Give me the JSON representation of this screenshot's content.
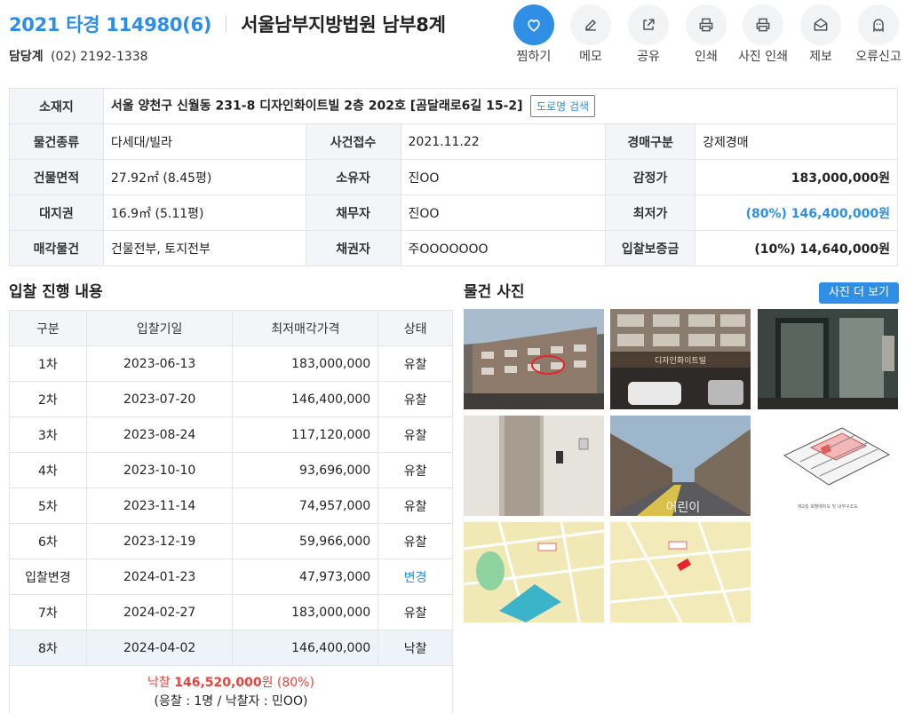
{
  "header": {
    "case_number": "2021 타경 114980(6)",
    "court": "서울남부지방법원 남부8계",
    "contact_label": "담당계",
    "contact_phone": "(02) 2192-1338"
  },
  "actions": [
    {
      "label": "찜하기",
      "icon": "heart-icon"
    },
    {
      "label": "메모",
      "icon": "edit-icon"
    },
    {
      "label": "공유",
      "icon": "share-icon"
    },
    {
      "label": "인쇄",
      "icon": "print-icon"
    },
    {
      "label": "사진 인쇄",
      "icon": "print-icon"
    },
    {
      "label": "제보",
      "icon": "mail-icon"
    },
    {
      "label": "오류신고",
      "icon": "ghost-icon"
    }
  ],
  "info": {
    "address_label": "소재지",
    "address": "서울 양천구 신월동 231-8 디자인화이트빌 2층 202호 [곰달래로6길 15-2]",
    "road_search": "도로명 검색",
    "rows": [
      {
        "l1": "물건종류",
        "v1": "다세대/빌라",
        "l2": "사건접수",
        "v2": "2021.11.22",
        "l3": "경매구분",
        "v3": "강제경매"
      },
      {
        "l1": "건물면적",
        "v1": "27.92㎡ (8.45평)",
        "l2": "소유자",
        "v2": "진OO",
        "l3": "감정가",
        "v3": "183,000,000원"
      },
      {
        "l1": "대지권",
        "v1": "16.9㎡ (5.11평)",
        "l2": "채무자",
        "v2": "진OO",
        "l3": "최저가",
        "v3": "(80%) 146,400,000원"
      },
      {
        "l1": "매각물건",
        "v1": "건물전부, 토지전부",
        "l2": "채권자",
        "v2": "주OOOOOOO",
        "l3": "입찰보증금",
        "v3": "(10%) 14,640,000원"
      }
    ]
  },
  "bid_section": {
    "title": "입찰 진행 내용",
    "headers": [
      "구분",
      "입찰기일",
      "최저매각가격",
      "상태"
    ],
    "rows": [
      {
        "round": "1차",
        "date": "2023-06-13",
        "price": "183,000,000",
        "status": "유찰"
      },
      {
        "round": "2차",
        "date": "2023-07-20",
        "price": "146,400,000",
        "status": "유찰"
      },
      {
        "round": "3차",
        "date": "2023-08-24",
        "price": "117,120,000",
        "status": "유찰"
      },
      {
        "round": "4차",
        "date": "2023-10-10",
        "price": "93,696,000",
        "status": "유찰"
      },
      {
        "round": "5차",
        "date": "2023-11-14",
        "price": "74,957,000",
        "status": "유찰"
      },
      {
        "round": "6차",
        "date": "2023-12-19",
        "price": "59,966,000",
        "status": "유찰"
      },
      {
        "round": "입찰변경",
        "date": "2024-01-23",
        "price": "47,973,000",
        "status": "변경"
      },
      {
        "round": "7차",
        "date": "2024-02-27",
        "price": "183,000,000",
        "status": "유찰"
      },
      {
        "round": "8차",
        "date": "2024-04-02",
        "price": "146,400,000",
        "status": "낙찰"
      }
    ],
    "result_label": "낙찰",
    "result_price": "146,520,000",
    "result_unit": "원",
    "result_pct": "(80%)",
    "result_detail": "(응찰 : 1명 / 낙찰자 : 민OO)"
  },
  "photos": {
    "title": "물건 사진",
    "more": "사진 더 보기",
    "sign_text": "디자인화이트빌",
    "road_text": "어린이",
    "floor_caption": "제2층 호별배치도 및 내부구조도"
  },
  "colors": {
    "accent": "#2c8ee8",
    "sold": "#e8423a"
  }
}
